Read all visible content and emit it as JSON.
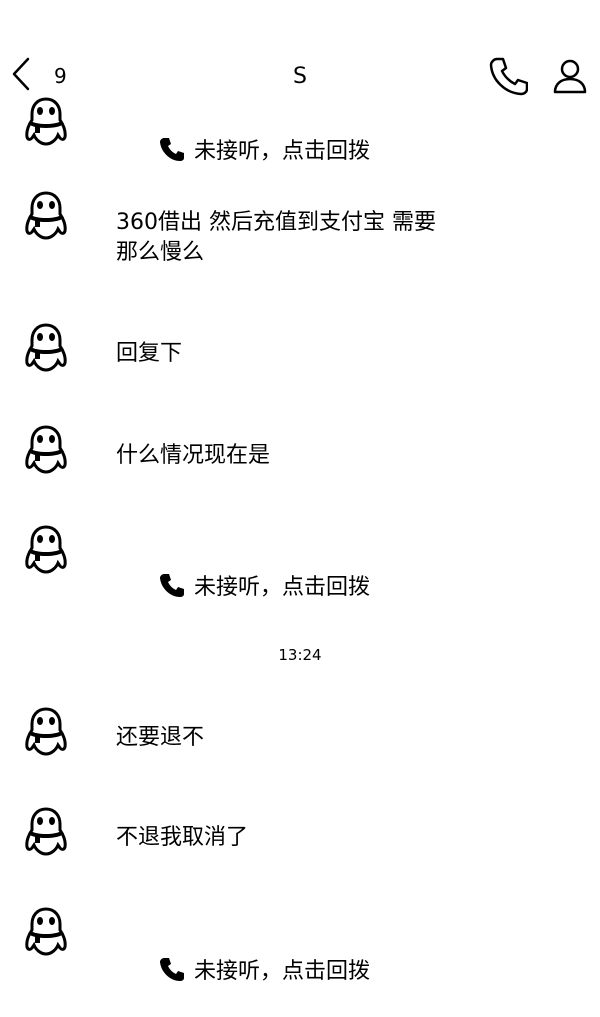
{
  "header": {
    "unread_count": "9",
    "title": "S"
  },
  "messages": [
    {
      "text": "未接听，点击回拨",
      "missed_call": true
    },
    {
      "text": "360借出 然后充值到支付宝 需要\n那么慢么",
      "missed_call": false
    },
    {
      "text": "回复下",
      "missed_call": false
    },
    {
      "text": "什么情况现在是",
      "missed_call": false
    },
    {
      "text": "未接听，点击回拨",
      "missed_call": true
    },
    {
      "text": "还要退不",
      "missed_call": false
    },
    {
      "text": "不退我取消了",
      "missed_call": false
    },
    {
      "text": "未接听，点击回拨",
      "missed_call": true
    }
  ],
  "timestamp": "13:24",
  "icons": {
    "back": "chevron-left-icon",
    "call": "phone-icon",
    "profile": "person-icon",
    "avatar": "penguin-avatar-icon"
  }
}
